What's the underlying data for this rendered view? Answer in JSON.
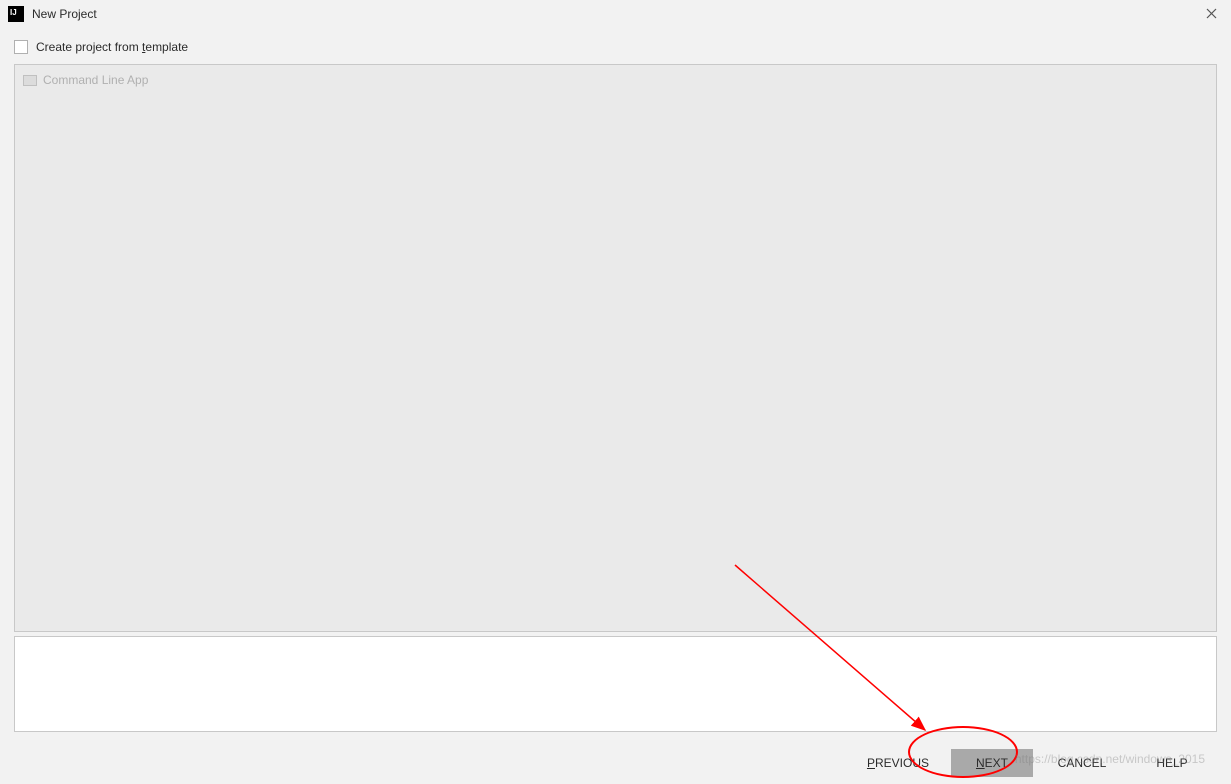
{
  "titlebar": {
    "title": "New Project"
  },
  "content": {
    "checkbox_label_prefix": "Create project from ",
    "checkbox_label_underline": "t",
    "checkbox_label_suffix": "emplate",
    "template_item": "Command Line App"
  },
  "buttons": {
    "previous_u": "P",
    "previous_rest": "REVIOUS",
    "next_u": "N",
    "next_rest": "EXT",
    "cancel": "CANCEL",
    "help": "HELP"
  },
  "watermark": "https://blog.csdn.net/windows_2015"
}
